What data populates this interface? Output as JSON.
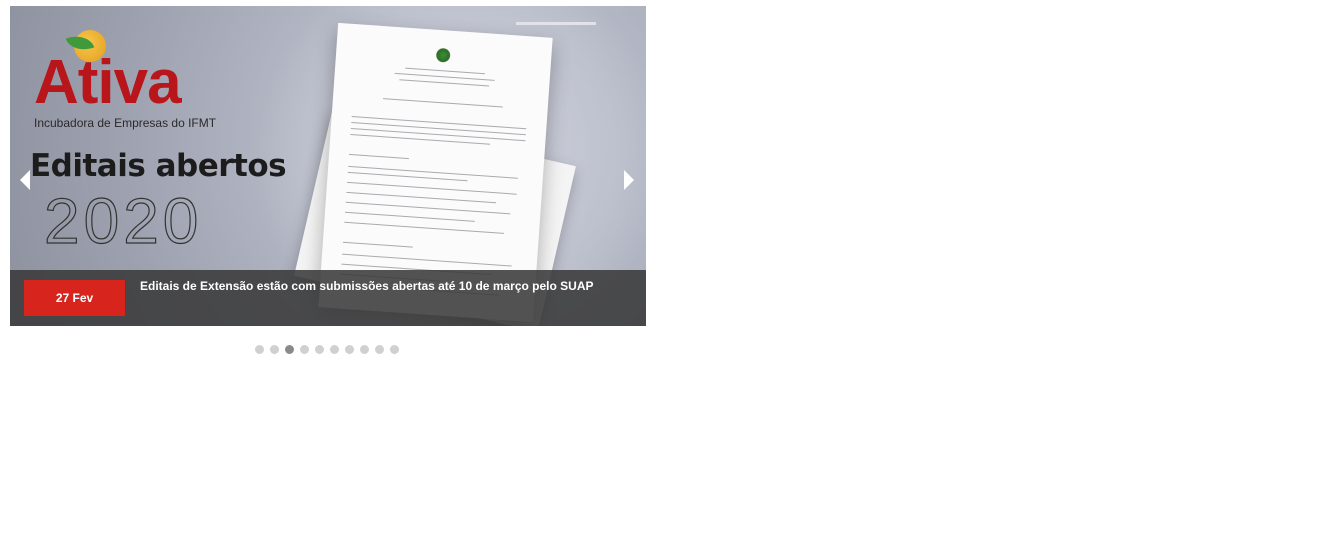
{
  "slider": {
    "logo_word": "Ativa",
    "logo_subtitle": "Incubadora de Empresas do IFMT",
    "headline": "Editais abertos",
    "year": "2020",
    "caption": {
      "date": "27 Fev",
      "title": "Editais de Extensão estão com submissões abertas até 10 de março pelo SUAP"
    },
    "dots": {
      "count": 10,
      "active_index": 2
    },
    "colors": {
      "badge": "#d7251e",
      "logo": "#b8161b",
      "caption_bg": "#3a3a3a"
    }
  }
}
